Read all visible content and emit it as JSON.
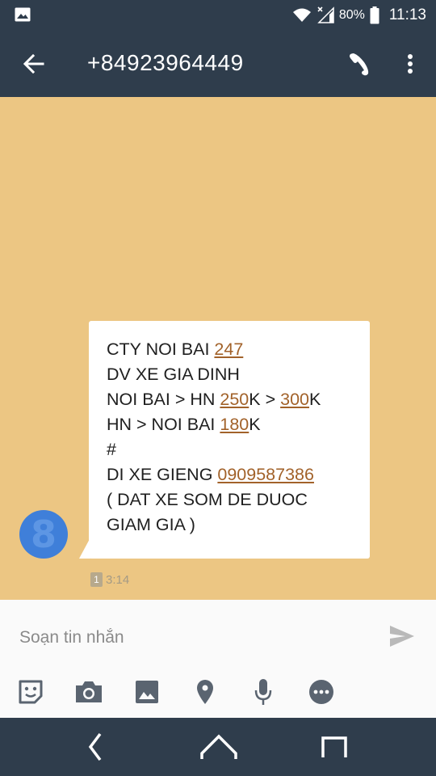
{
  "status_bar": {
    "battery": "80%",
    "time": "11:13",
    "icons": [
      "gallery-icon",
      "wifi-icon",
      "signal-icon",
      "battery-icon"
    ]
  },
  "app_bar": {
    "title": "+84923964449",
    "icons": [
      "back-arrow-icon",
      "phone-icon",
      "more-vert-icon"
    ]
  },
  "conversation": {
    "background_color": "#ecc683",
    "avatar_color": "#3f7fd9",
    "avatar_glyph": "8",
    "message": {
      "lines": [
        [
          {
            "t": "CTY NOI BAI "
          },
          {
            "t": "247",
            "link": true
          }
        ],
        [
          {
            "t": "DV XE GIA DINH"
          }
        ],
        [
          {
            "t": "NOI BAI > HN "
          },
          {
            "t": "250",
            "link": true
          },
          {
            "t": "K > "
          },
          {
            "t": "300",
            "link": true
          },
          {
            "t": "K"
          }
        ],
        [
          {
            "t": "HN > NOI BAI "
          },
          {
            "t": "180",
            "link": true
          },
          {
            "t": "K"
          }
        ],
        [
          {
            "t": "#"
          }
        ],
        [
          {
            "t": "DI XE GIENG "
          },
          {
            "t": "0909587386",
            "link": true
          }
        ],
        [
          {
            "t": "( DAT XE SOM DE DUOC"
          }
        ],
        [
          {
            "t": "GIAM GIA )"
          }
        ]
      ],
      "sim_badge": "1",
      "timestamp": "3:14"
    },
    "link_color": "#a2622a"
  },
  "composer": {
    "placeholder": "Soạn tin nhắn",
    "value": "",
    "tools": [
      "sticker-icon",
      "camera-icon",
      "image-icon",
      "location-icon",
      "mic-icon",
      "more-horiz-icon"
    ],
    "send_icon": "send-icon"
  },
  "nav_bar": {
    "buttons": [
      "nav-back-icon",
      "nav-home-icon",
      "nav-recents-icon"
    ]
  }
}
